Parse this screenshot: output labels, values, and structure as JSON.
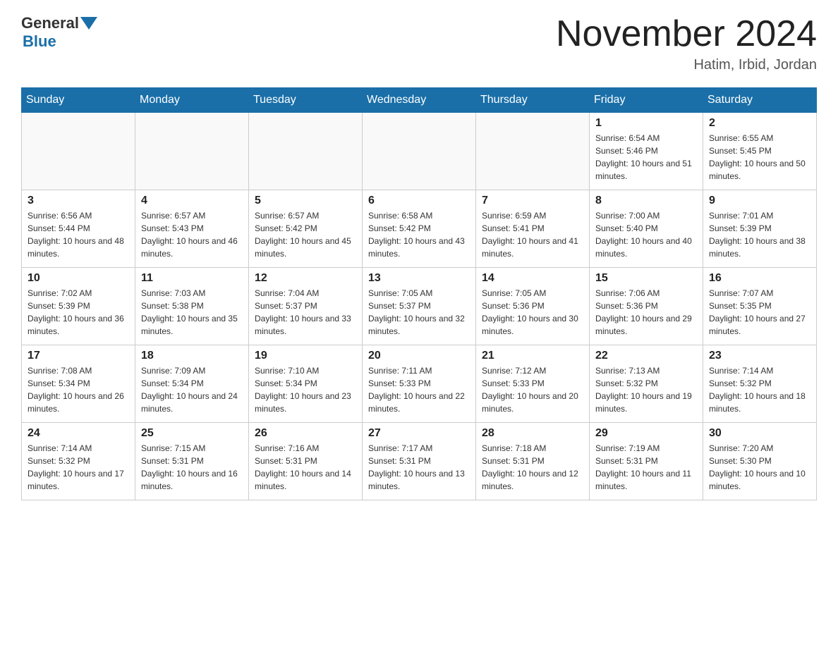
{
  "header": {
    "title": "November 2024",
    "location": "Hatim, Irbid, Jordan",
    "logo_general": "General",
    "logo_blue": "Blue"
  },
  "days_of_week": [
    "Sunday",
    "Monday",
    "Tuesday",
    "Wednesday",
    "Thursday",
    "Friday",
    "Saturday"
  ],
  "weeks": [
    [
      {
        "day": "",
        "sunrise": "",
        "sunset": "",
        "daylight": ""
      },
      {
        "day": "",
        "sunrise": "",
        "sunset": "",
        "daylight": ""
      },
      {
        "day": "",
        "sunrise": "",
        "sunset": "",
        "daylight": ""
      },
      {
        "day": "",
        "sunrise": "",
        "sunset": "",
        "daylight": ""
      },
      {
        "day": "",
        "sunrise": "",
        "sunset": "",
        "daylight": ""
      },
      {
        "day": "1",
        "sunrise": "Sunrise: 6:54 AM",
        "sunset": "Sunset: 5:46 PM",
        "daylight": "Daylight: 10 hours and 51 minutes."
      },
      {
        "day": "2",
        "sunrise": "Sunrise: 6:55 AM",
        "sunset": "Sunset: 5:45 PM",
        "daylight": "Daylight: 10 hours and 50 minutes."
      }
    ],
    [
      {
        "day": "3",
        "sunrise": "Sunrise: 6:56 AM",
        "sunset": "Sunset: 5:44 PM",
        "daylight": "Daylight: 10 hours and 48 minutes."
      },
      {
        "day": "4",
        "sunrise": "Sunrise: 6:57 AM",
        "sunset": "Sunset: 5:43 PM",
        "daylight": "Daylight: 10 hours and 46 minutes."
      },
      {
        "day": "5",
        "sunrise": "Sunrise: 6:57 AM",
        "sunset": "Sunset: 5:42 PM",
        "daylight": "Daylight: 10 hours and 45 minutes."
      },
      {
        "day": "6",
        "sunrise": "Sunrise: 6:58 AM",
        "sunset": "Sunset: 5:42 PM",
        "daylight": "Daylight: 10 hours and 43 minutes."
      },
      {
        "day": "7",
        "sunrise": "Sunrise: 6:59 AM",
        "sunset": "Sunset: 5:41 PM",
        "daylight": "Daylight: 10 hours and 41 minutes."
      },
      {
        "day": "8",
        "sunrise": "Sunrise: 7:00 AM",
        "sunset": "Sunset: 5:40 PM",
        "daylight": "Daylight: 10 hours and 40 minutes."
      },
      {
        "day": "9",
        "sunrise": "Sunrise: 7:01 AM",
        "sunset": "Sunset: 5:39 PM",
        "daylight": "Daylight: 10 hours and 38 minutes."
      }
    ],
    [
      {
        "day": "10",
        "sunrise": "Sunrise: 7:02 AM",
        "sunset": "Sunset: 5:39 PM",
        "daylight": "Daylight: 10 hours and 36 minutes."
      },
      {
        "day": "11",
        "sunrise": "Sunrise: 7:03 AM",
        "sunset": "Sunset: 5:38 PM",
        "daylight": "Daylight: 10 hours and 35 minutes."
      },
      {
        "day": "12",
        "sunrise": "Sunrise: 7:04 AM",
        "sunset": "Sunset: 5:37 PM",
        "daylight": "Daylight: 10 hours and 33 minutes."
      },
      {
        "day": "13",
        "sunrise": "Sunrise: 7:05 AM",
        "sunset": "Sunset: 5:37 PM",
        "daylight": "Daylight: 10 hours and 32 minutes."
      },
      {
        "day": "14",
        "sunrise": "Sunrise: 7:05 AM",
        "sunset": "Sunset: 5:36 PM",
        "daylight": "Daylight: 10 hours and 30 minutes."
      },
      {
        "day": "15",
        "sunrise": "Sunrise: 7:06 AM",
        "sunset": "Sunset: 5:36 PM",
        "daylight": "Daylight: 10 hours and 29 minutes."
      },
      {
        "day": "16",
        "sunrise": "Sunrise: 7:07 AM",
        "sunset": "Sunset: 5:35 PM",
        "daylight": "Daylight: 10 hours and 27 minutes."
      }
    ],
    [
      {
        "day": "17",
        "sunrise": "Sunrise: 7:08 AM",
        "sunset": "Sunset: 5:34 PM",
        "daylight": "Daylight: 10 hours and 26 minutes."
      },
      {
        "day": "18",
        "sunrise": "Sunrise: 7:09 AM",
        "sunset": "Sunset: 5:34 PM",
        "daylight": "Daylight: 10 hours and 24 minutes."
      },
      {
        "day": "19",
        "sunrise": "Sunrise: 7:10 AM",
        "sunset": "Sunset: 5:34 PM",
        "daylight": "Daylight: 10 hours and 23 minutes."
      },
      {
        "day": "20",
        "sunrise": "Sunrise: 7:11 AM",
        "sunset": "Sunset: 5:33 PM",
        "daylight": "Daylight: 10 hours and 22 minutes."
      },
      {
        "day": "21",
        "sunrise": "Sunrise: 7:12 AM",
        "sunset": "Sunset: 5:33 PM",
        "daylight": "Daylight: 10 hours and 20 minutes."
      },
      {
        "day": "22",
        "sunrise": "Sunrise: 7:13 AM",
        "sunset": "Sunset: 5:32 PM",
        "daylight": "Daylight: 10 hours and 19 minutes."
      },
      {
        "day": "23",
        "sunrise": "Sunrise: 7:14 AM",
        "sunset": "Sunset: 5:32 PM",
        "daylight": "Daylight: 10 hours and 18 minutes."
      }
    ],
    [
      {
        "day": "24",
        "sunrise": "Sunrise: 7:14 AM",
        "sunset": "Sunset: 5:32 PM",
        "daylight": "Daylight: 10 hours and 17 minutes."
      },
      {
        "day": "25",
        "sunrise": "Sunrise: 7:15 AM",
        "sunset": "Sunset: 5:31 PM",
        "daylight": "Daylight: 10 hours and 16 minutes."
      },
      {
        "day": "26",
        "sunrise": "Sunrise: 7:16 AM",
        "sunset": "Sunset: 5:31 PM",
        "daylight": "Daylight: 10 hours and 14 minutes."
      },
      {
        "day": "27",
        "sunrise": "Sunrise: 7:17 AM",
        "sunset": "Sunset: 5:31 PM",
        "daylight": "Daylight: 10 hours and 13 minutes."
      },
      {
        "day": "28",
        "sunrise": "Sunrise: 7:18 AM",
        "sunset": "Sunset: 5:31 PM",
        "daylight": "Daylight: 10 hours and 12 minutes."
      },
      {
        "day": "29",
        "sunrise": "Sunrise: 7:19 AM",
        "sunset": "Sunset: 5:31 PM",
        "daylight": "Daylight: 10 hours and 11 minutes."
      },
      {
        "day": "30",
        "sunrise": "Sunrise: 7:20 AM",
        "sunset": "Sunset: 5:30 PM",
        "daylight": "Daylight: 10 hours and 10 minutes."
      }
    ]
  ]
}
